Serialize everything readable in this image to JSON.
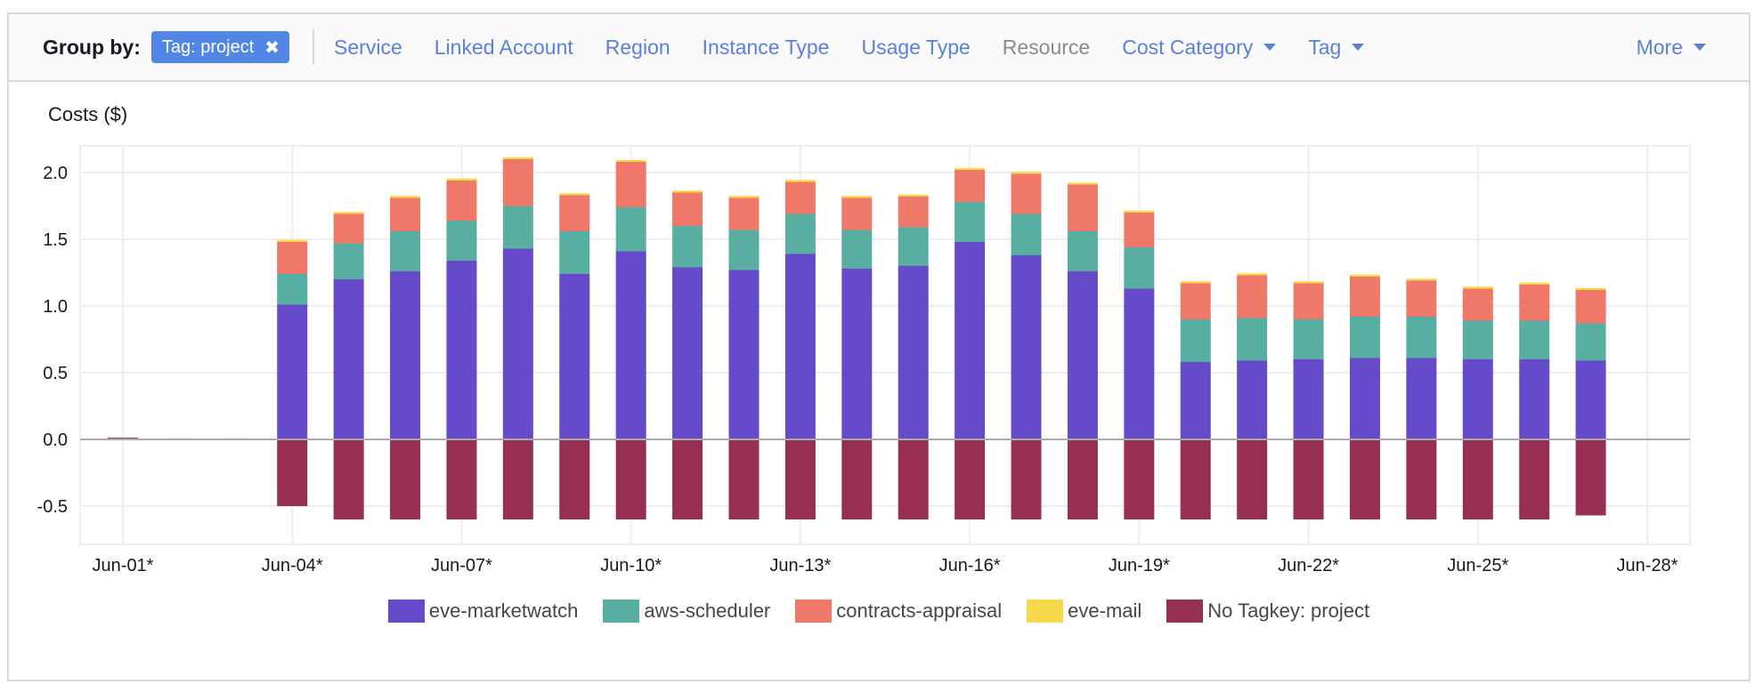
{
  "toolbar": {
    "group_by_label": "Group by:",
    "active_chip": {
      "label": "Tag: project",
      "remove_icon": "close-icon"
    },
    "options": [
      {
        "label": "Service",
        "enabled": true,
        "dropdown": false
      },
      {
        "label": "Linked Account",
        "enabled": true,
        "dropdown": false
      },
      {
        "label": "Region",
        "enabled": true,
        "dropdown": false
      },
      {
        "label": "Instance Type",
        "enabled": true,
        "dropdown": false
      },
      {
        "label": "Usage Type",
        "enabled": true,
        "dropdown": false
      },
      {
        "label": "Resource",
        "enabled": false,
        "dropdown": false
      },
      {
        "label": "Cost Category",
        "enabled": true,
        "dropdown": true
      },
      {
        "label": "Tag",
        "enabled": true,
        "dropdown": true
      }
    ],
    "more_label": "More"
  },
  "colors": {
    "link": "#5a7fdc",
    "chip": "#5286e6",
    "grid": "#eeeeee",
    "zero_line": "#aaaaaa"
  },
  "chart_data": {
    "type": "bar",
    "stacked": true,
    "title": "Costs ($)",
    "xlabel": "",
    "ylabel": "Costs ($)",
    "ylim": [
      -0.8,
      2.2
    ],
    "yticks": [
      2.0,
      1.5,
      1.0,
      0.5,
      0.0,
      -0.5
    ],
    "ytick_labels": [
      "2.0",
      "1.5",
      "1.0",
      "0.5",
      "0.0",
      "-0.5"
    ],
    "xtick_labels": [
      "Jun-01*",
      "Jun-04*",
      "Jun-07*",
      "Jun-10*",
      "Jun-13*",
      "Jun-16*",
      "Jun-19*",
      "Jun-22*",
      "Jun-25*",
      "Jun-28*"
    ],
    "xtick_positions": [
      0,
      3,
      6,
      9,
      12,
      15,
      18,
      21,
      24,
      27
    ],
    "grid": true,
    "legend_position": "bottom",
    "categories": [
      "Jun-01*",
      "Jun-02*",
      "Jun-03*",
      "Jun-04*",
      "Jun-05*",
      "Jun-06*",
      "Jun-07*",
      "Jun-08*",
      "Jun-09*",
      "Jun-10*",
      "Jun-11*",
      "Jun-12*",
      "Jun-13*",
      "Jun-14*",
      "Jun-15*",
      "Jun-16*",
      "Jun-17*",
      "Jun-18*",
      "Jun-19*",
      "Jun-20*",
      "Jun-21*",
      "Jun-22*",
      "Jun-23*",
      "Jun-24*",
      "Jun-25*",
      "Jun-26*",
      "Jun-27*",
      "Jun-28*"
    ],
    "series": [
      {
        "name": "eve-marketwatch",
        "color": "#654bc9",
        "values": [
          0,
          0,
          0,
          1.01,
          1.2,
          1.26,
          1.34,
          1.43,
          1.24,
          1.41,
          1.29,
          1.27,
          1.39,
          1.28,
          1.3,
          1.48,
          1.38,
          1.26,
          1.13,
          0.58,
          0.59,
          0.6,
          0.61,
          0.61,
          0.6,
          0.6,
          0.59,
          0
        ]
      },
      {
        "name": "aws-scheduler",
        "color": "#58afa1",
        "values": [
          0,
          0,
          0,
          0.23,
          0.27,
          0.3,
          0.3,
          0.32,
          0.32,
          0.33,
          0.31,
          0.3,
          0.3,
          0.29,
          0.29,
          0.3,
          0.31,
          0.3,
          0.31,
          0.32,
          0.32,
          0.3,
          0.31,
          0.31,
          0.29,
          0.29,
          0.28,
          0
        ]
      },
      {
        "name": "contracts-appraisal",
        "color": "#ef7868",
        "values": [
          0,
          0,
          0,
          0.24,
          0.22,
          0.25,
          0.3,
          0.35,
          0.27,
          0.34,
          0.25,
          0.24,
          0.24,
          0.24,
          0.23,
          0.24,
          0.3,
          0.35,
          0.26,
          0.27,
          0.32,
          0.27,
          0.3,
          0.27,
          0.24,
          0.27,
          0.25,
          0
        ]
      },
      {
        "name": "eve-mail",
        "color": "#f8d84b",
        "values": [
          0,
          0,
          0,
          0.015,
          0.015,
          0.015,
          0.015,
          0.015,
          0.015,
          0.015,
          0.015,
          0.015,
          0.015,
          0.015,
          0.015,
          0.015,
          0.015,
          0.015,
          0.015,
          0.015,
          0.015,
          0.015,
          0.015,
          0.015,
          0.015,
          0.015,
          0.015,
          0
        ]
      },
      {
        "name": "No Tagkey: project",
        "color": "#972f52",
        "values": [
          0.013,
          0.007,
          0.007,
          -0.5,
          -0.6,
          -0.6,
          -0.6,
          -0.6,
          -0.6,
          -0.6,
          -0.6,
          -0.6,
          -0.6,
          -0.6,
          -0.6,
          -0.6,
          -0.6,
          -0.6,
          -0.6,
          -0.6,
          -0.6,
          -0.6,
          -0.6,
          -0.6,
          -0.6,
          -0.6,
          -0.57,
          0
        ]
      }
    ]
  }
}
